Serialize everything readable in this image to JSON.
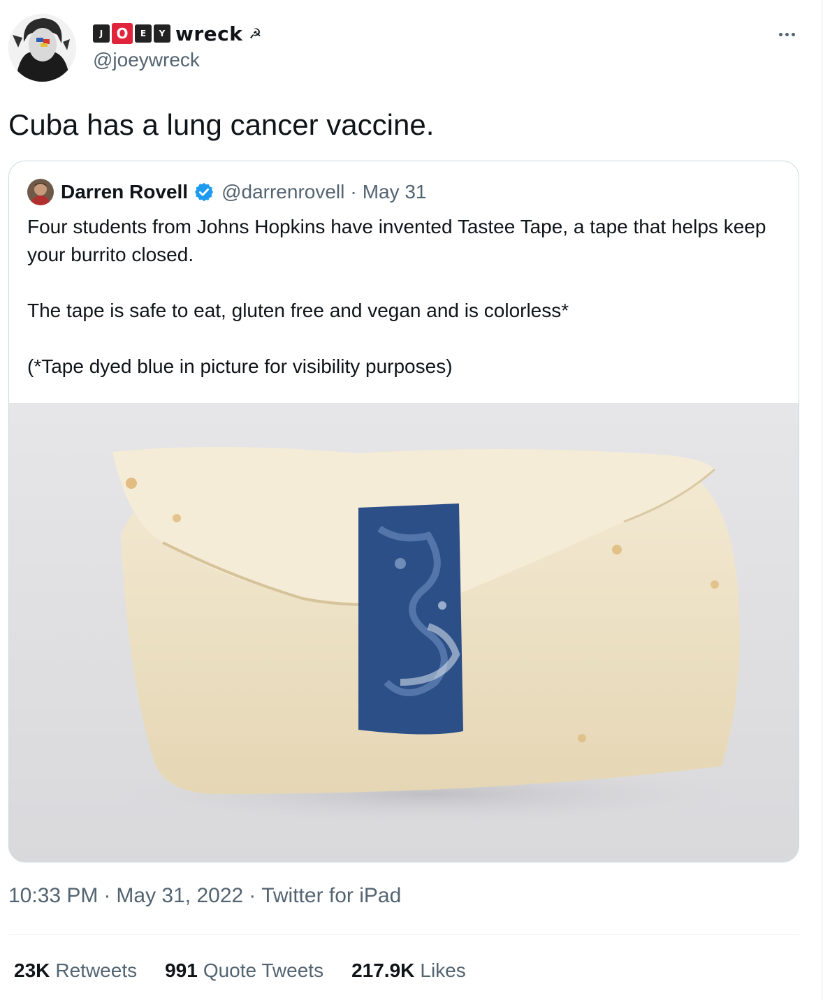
{
  "author": {
    "name_tiles": [
      "J",
      "O",
      "E",
      "Y"
    ],
    "name_suffix": "wreck",
    "name_emoji": "☭",
    "handle": "@joeywreck"
  },
  "tweet": {
    "text": "Cuba has a lung cancer vaccine."
  },
  "quoted": {
    "name": "Darren Rovell",
    "handle": "@darrenrovell",
    "separator": "·",
    "date": "May 31",
    "paragraphs": [
      "Four students from Johns Hopkins have invented Tastee Tape, a tape that helps keep your burrito closed.",
      "The tape is safe to eat, gluten free and vegan and is colorless*",
      "(*Tape dyed blue in picture for visibility purposes)"
    ]
  },
  "meta": {
    "time": "10:33 PM",
    "sep1": "·",
    "date": "May 31, 2022",
    "sep2": "·",
    "source": "Twitter for iPad"
  },
  "stats": {
    "retweets_num": "23K",
    "retweets_label": "Retweets",
    "quotes_num": "991",
    "quotes_label": "Quote Tweets",
    "likes_num": "217.9K",
    "likes_label": "Likes"
  },
  "colors": {
    "verified": "#1d9bf0",
    "tape": "#2c4f88",
    "tortilla": "#efe3c6"
  }
}
